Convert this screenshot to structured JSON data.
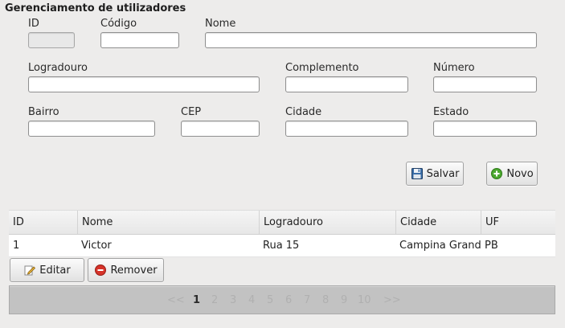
{
  "form": {
    "title": "Gerenciamento de utilizadores",
    "labels": {
      "id": "ID",
      "codigo": "Código",
      "nome": "Nome",
      "logradouro": "Logradouro",
      "complemento": "Complemento",
      "numero": "Número",
      "bairro": "Bairro",
      "cep": "CEP",
      "cidade": "Cidade",
      "estado": "Estado"
    },
    "values": {
      "id": "",
      "codigo": "",
      "nome": "",
      "logradouro": "",
      "complemento": "",
      "numero": "",
      "bairro": "",
      "cep": "",
      "cidade": "",
      "estado": ""
    },
    "buttons": {
      "salvar": "Salvar",
      "novo": "Novo"
    }
  },
  "table": {
    "columns": [
      "ID",
      "Nome",
      "Logradouro",
      "Cidade",
      "UF"
    ],
    "rows": [
      [
        "1",
        "Victor",
        "Rua 15",
        "Campina Grande",
        "PB"
      ]
    ]
  },
  "actions": {
    "editar": "Editar",
    "remover": "Remover"
  },
  "pager": {
    "prev": "<<",
    "pages": [
      "1",
      "2",
      "3",
      "4",
      "5",
      "6",
      "7",
      "8",
      "9",
      "10"
    ],
    "current": "1",
    "next": ">>"
  },
  "icons": {
    "save": "floppy-disk-icon",
    "new": "green-plus-icon",
    "edit": "pencil-icon",
    "remove": "red-minus-icon"
  },
  "colors": {
    "new_green": "#4aa72e",
    "remove_red": "#d6332a",
    "save_blue": "#3b6ea8"
  }
}
